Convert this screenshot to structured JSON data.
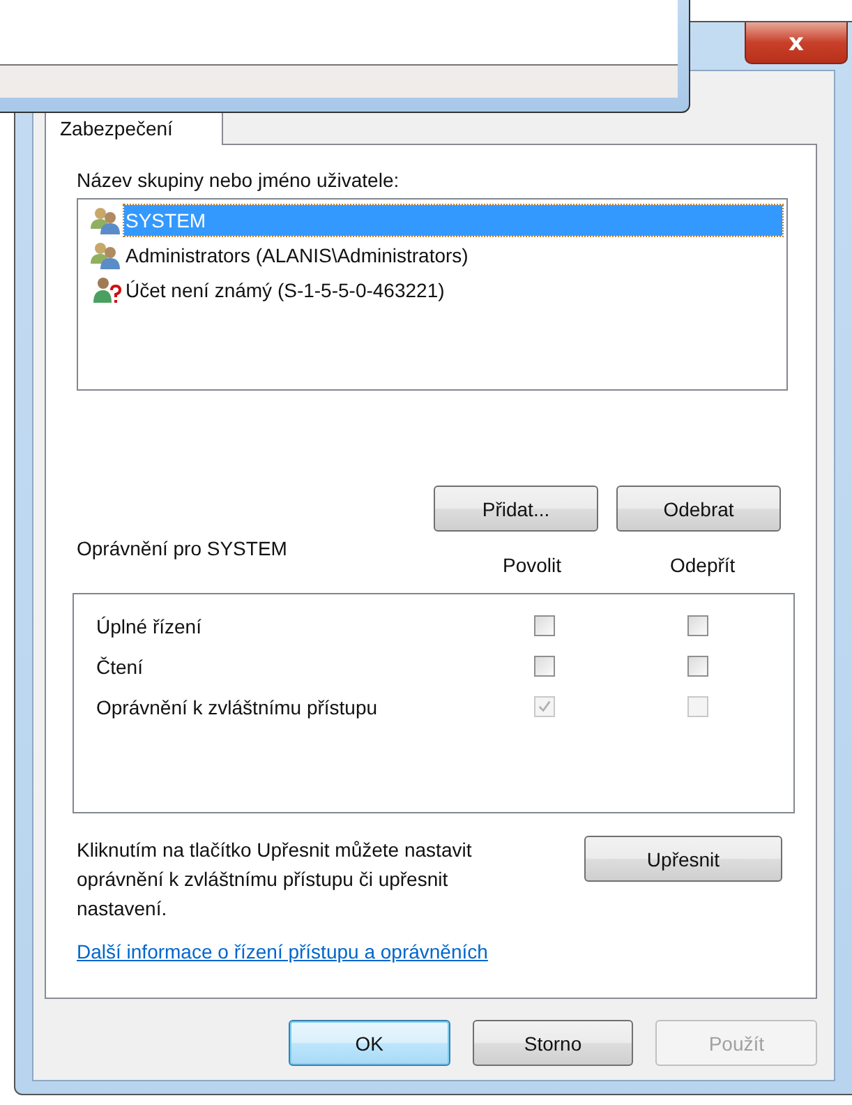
{
  "window": {
    "close": "x"
  },
  "tabs": [
    {
      "label": "Zabezpečení",
      "selected": true
    }
  ],
  "principals_label": "Název skupiny nebo jméno uživatele:",
  "principals": [
    {
      "name": "SYSTEM",
      "kind": "group",
      "selected": true
    },
    {
      "name": "Administrators (ALANIS\\Administrators)",
      "kind": "group",
      "selected": false
    },
    {
      "name": "Účet není známý (S-1-5-5-0-463221)",
      "kind": "unknown",
      "selected": false
    }
  ],
  "list_buttons": [
    {
      "label": "Přidat...",
      "disabled": false
    },
    {
      "label": "Odebrat",
      "disabled": false
    }
  ],
  "permissions_label": "Oprávnění pro SYSTEM",
  "columns": [
    "Povolit",
    "Odepřít"
  ],
  "permissions": [
    {
      "name": "Úplné řízení",
      "allow": {
        "checked": false,
        "disabled": false
      },
      "deny": {
        "checked": false,
        "disabled": false
      }
    },
    {
      "name": "Čtení",
      "allow": {
        "checked": false,
        "disabled": false
      },
      "deny": {
        "checked": false,
        "disabled": false
      }
    },
    {
      "name": "Oprávnění k zvláštnímu přístupu",
      "allow": {
        "checked": true,
        "disabled": true
      },
      "deny": {
        "checked": false,
        "disabled": true
      }
    }
  ],
  "advanced_text": "Kliknutím na tlačítko Upřesnit můžete nastavit oprávnění k zvláštnímu přístupu či upřesnit nastavení.",
  "advanced_button": {
    "label": "Upřesnit",
    "disabled": false
  },
  "help_link": "Další informace o řízení přístupu a oprávněních",
  "buttons": [
    {
      "label": "OK",
      "default": true,
      "disabled": false
    },
    {
      "label": "Storno",
      "default": false,
      "disabled": false
    },
    {
      "label": "Použít",
      "default": false,
      "disabled": true
    }
  ]
}
